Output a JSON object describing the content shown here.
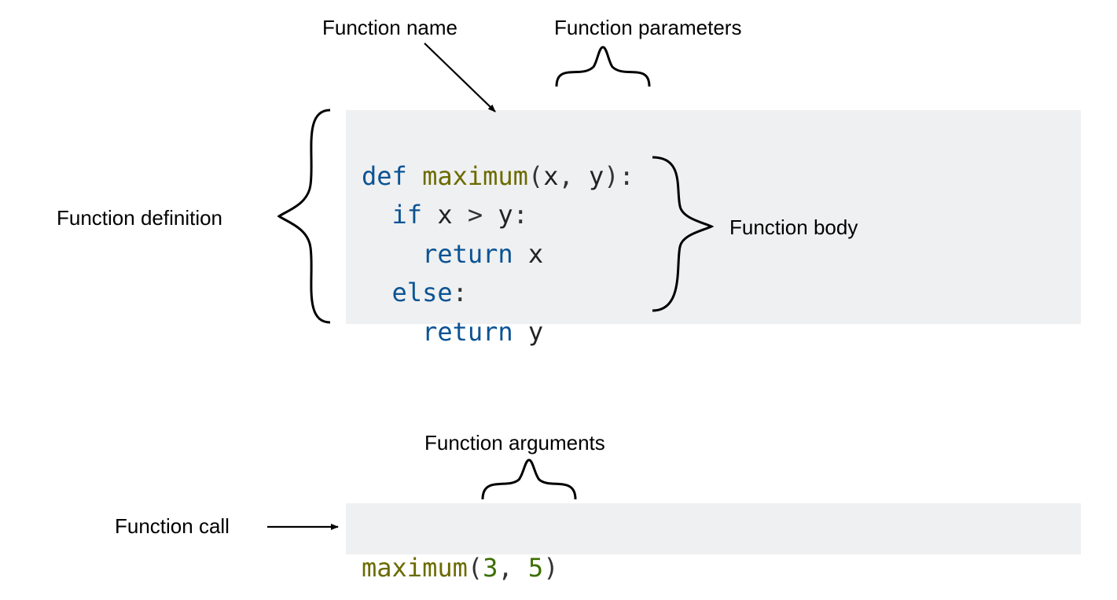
{
  "labels": {
    "func_name": "Function name",
    "func_params": "Function parameters",
    "func_def": "Function definition",
    "func_body": "Function body",
    "func_args": "Function arguments",
    "func_call": "Function call"
  },
  "code1": {
    "line1": {
      "kw": "def",
      "sp1": " ",
      "fn": "maximum",
      "open": "(",
      "p1": "x",
      "comma": ", ",
      "p2": "y",
      "close": ")",
      "colon": ":"
    },
    "line2": {
      "indent": "  ",
      "kw": "if",
      "sp": " ",
      "v1": "x",
      "op": " > ",
      "v2": "y",
      "colon": ":"
    },
    "line3": {
      "indent": "    ",
      "kw": "return",
      "sp": " ",
      "v": "x"
    },
    "line4": {
      "indent": "  ",
      "kw": "else",
      "colon": ":"
    },
    "line5": {
      "indent": "    ",
      "kw": "return",
      "sp": " ",
      "v": "y"
    }
  },
  "code2": {
    "line1": {
      "fn": "maximum",
      "open": "(",
      "a1": "3",
      "comma": ", ",
      "a2": "5",
      "close": ")"
    }
  }
}
